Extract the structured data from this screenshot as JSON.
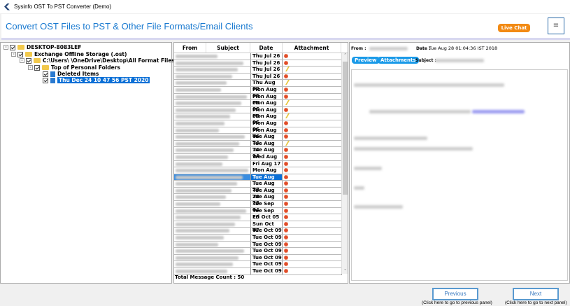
{
  "window": {
    "title": "Sysinfo OST To PST Converter (Demo)"
  },
  "header": {
    "title": "Convert OST Files to PST & Other File Formats/Email Clients",
    "live_chat": "Live Chat",
    "menu_icon": "≡"
  },
  "tree": {
    "root": "DESKTOP-8083LEF",
    "store": "Exchange Offline Storage (.ost)",
    "path": "C:\\Users\\        \\OneDrive\\Desktop\\All Format Files\\I",
    "top": "Top of Personal Folders",
    "deleted": "Deleted Items",
    "selected": "Thu Dec 24 10 47 56 PST 2020"
  },
  "list": {
    "columns": [
      "From",
      "Subject",
      "Date",
      "Attachment"
    ],
    "messages": [
      {
        "date": "Thu Jul 26",
        "att": "gear"
      },
      {
        "date": "Thu Jul 26",
        "att": "gear"
      },
      {
        "date": "Thu Jul 26",
        "att": "clip"
      },
      {
        "date": "Thu Jul 26",
        "att": "gear"
      },
      {
        "date": "Thu Aug 02",
        "att": "clip"
      },
      {
        "date": "Mon Aug 06",
        "att": "gear"
      },
      {
        "date": "Mon Aug 06",
        "att": "gear"
      },
      {
        "date": "Mon Aug 06",
        "att": "clip"
      },
      {
        "date": "Mon Aug 06",
        "att": "gear"
      },
      {
        "date": "Mon Aug 06",
        "att": "clip"
      },
      {
        "date": "Mon Aug 06",
        "att": "gear"
      },
      {
        "date": "Mon Aug 06",
        "att": "gear"
      },
      {
        "date": "Tue Aug 14",
        "att": "gear"
      },
      {
        "date": "Tue Aug 14",
        "att": "clip"
      },
      {
        "date": "Tue Aug 14",
        "att": "gear"
      },
      {
        "date": "Wed Aug",
        "att": "gear"
      },
      {
        "date": "Fri Aug 17",
        "att": "gear"
      },
      {
        "date": "Mon Aug 20",
        "att": "gear"
      },
      {
        "date": "Tue Aug 28",
        "att": "gear",
        "selected": true
      },
      {
        "date": "Tue Aug 28",
        "att": "gear"
      },
      {
        "date": "Tue Aug 28",
        "att": "gear"
      },
      {
        "date": "Tue Aug 28",
        "att": "gear"
      },
      {
        "date": "Tue Sep 04",
        "att": "gear"
      },
      {
        "date": "Tue Sep 25",
        "att": "gear"
      },
      {
        "date": "Fri Oct 05",
        "att": "gear"
      },
      {
        "date": "Sun Oct 07",
        "att": "gear"
      },
      {
        "date": "Tue Oct 09",
        "att": "gear"
      },
      {
        "date": "Tue Oct 09",
        "att": "gear"
      },
      {
        "date": "Tue Oct 09",
        "att": "gear"
      },
      {
        "date": "Tue Oct 09",
        "att": "gear"
      },
      {
        "date": "Tue Oct 09",
        "att": "gear"
      },
      {
        "date": "Tue Oct 09",
        "att": "gear"
      },
      {
        "date": "Tue Oct 09",
        "att": "gear"
      }
    ],
    "total": "Total Message Count : 50"
  },
  "preview": {
    "from_label": "From :",
    "date_label": "Date :",
    "date_value": "Tue Aug 28 01:04:36 IST 2018",
    "subject_label": "Subject :",
    "tab_preview": "Preview",
    "tab_attachments": "Attachments"
  },
  "footer": {
    "previous": "Previous",
    "previous_hint": "(Click here to go to previous panel)",
    "next": "Next",
    "next_hint": "(Click here to go to next panel)"
  }
}
